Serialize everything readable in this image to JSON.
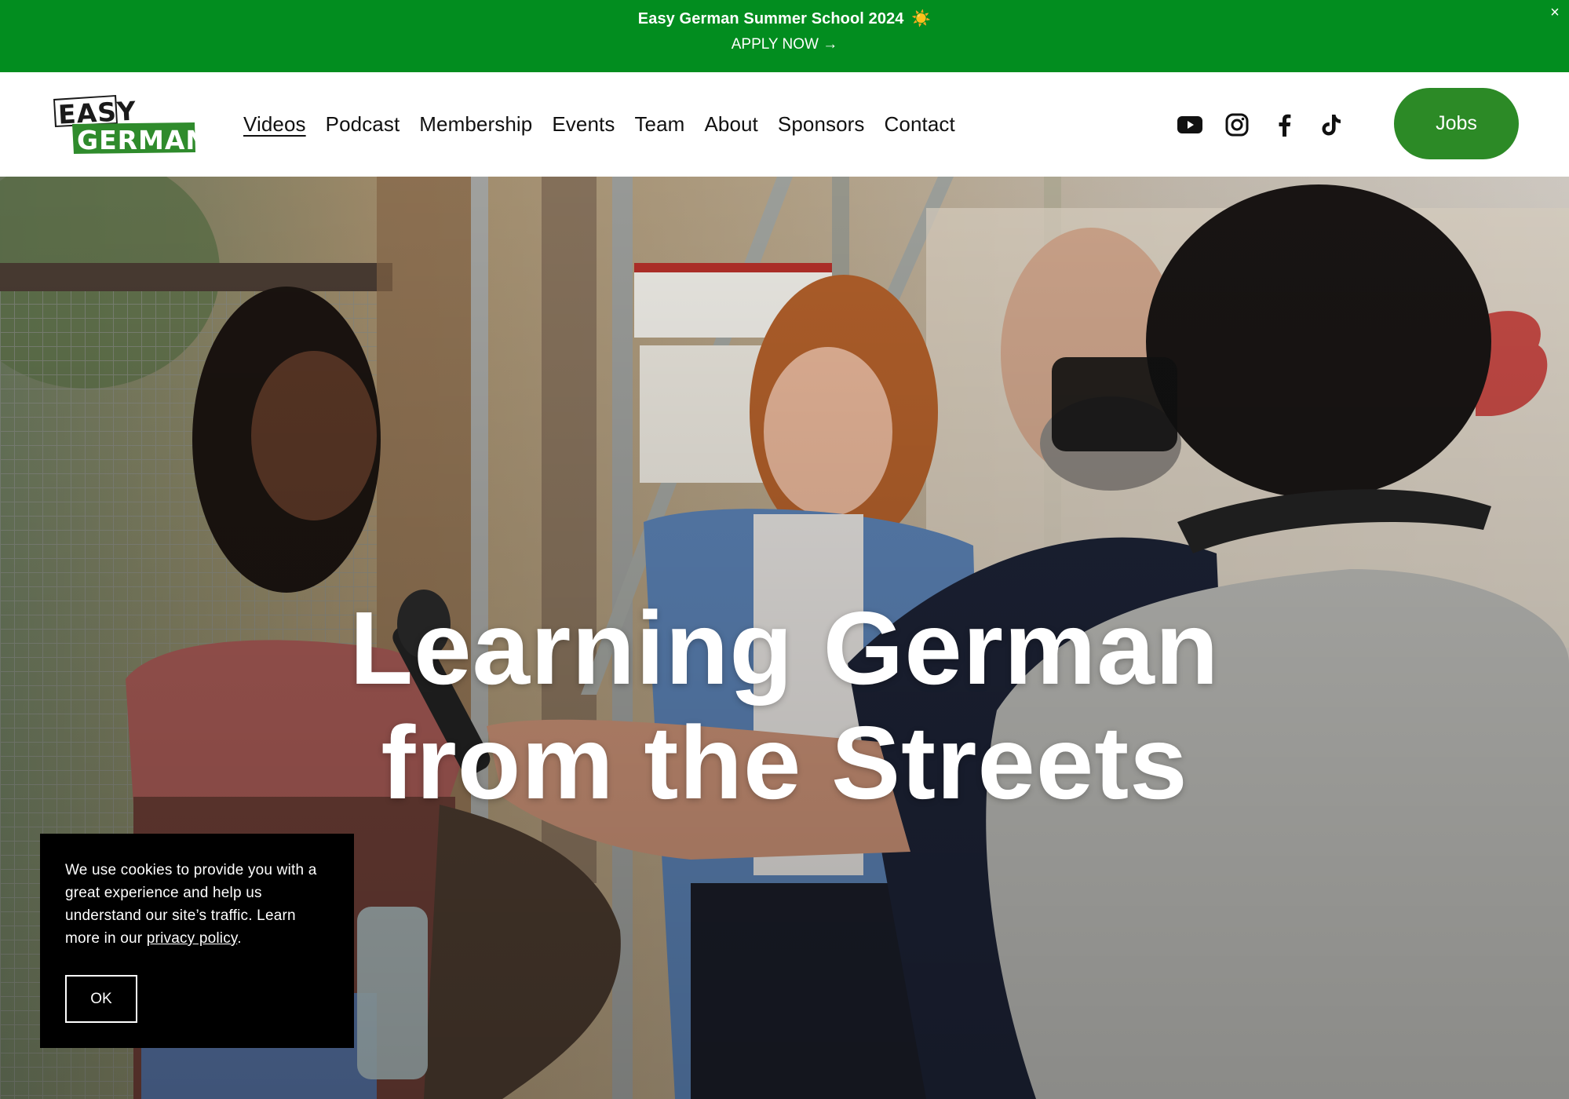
{
  "announcement": {
    "title": "Easy German Summer School 2024",
    "title_emoji": "☀️",
    "link_label": "APPLY NOW →",
    "close_label": "×",
    "background_color": "#028d1f"
  },
  "header": {
    "logo_alt": "EASY GERMAN",
    "logo_line1": "EASY",
    "logo_line2": "GERMAN",
    "nav": [
      {
        "label": "Videos",
        "active": true
      },
      {
        "label": "Podcast"
      },
      {
        "label": "Membership"
      },
      {
        "label": "Events"
      },
      {
        "label": "Team"
      },
      {
        "label": "About"
      },
      {
        "label": "Sponsors"
      },
      {
        "label": "Contact"
      }
    ],
    "socials": [
      {
        "icon": "youtube-icon"
      },
      {
        "icon": "instagram-icon"
      },
      {
        "icon": "facebook-icon"
      },
      {
        "icon": "tiktok-icon"
      }
    ],
    "jobs_label": "Jobs",
    "jobs_color": "#2c8a26"
  },
  "hero": {
    "title_line1": "Learning German",
    "title_line2": "from the Streets",
    "image_description_icon": "street-interview-photo"
  },
  "cookie": {
    "text_prefix": "We use cookies to provide you with a great experience and help us understand our site’s traffic. Learn more in our ",
    "link_label": "privacy policy",
    "text_suffix": ".",
    "ok_label": "OK"
  }
}
